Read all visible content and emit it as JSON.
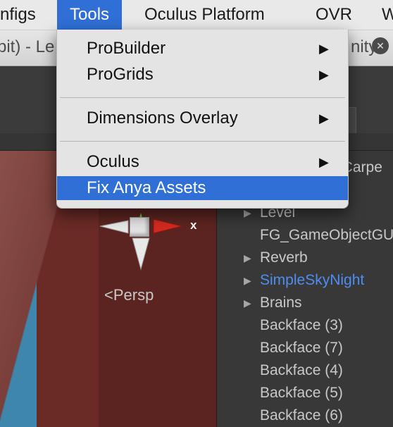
{
  "menubar": {
    "items": [
      "nfigs",
      "Tools",
      "Oculus Platform",
      "OVR",
      "W"
    ]
  },
  "titlebar": {
    "left_text": "bit) - Le",
    "right_text": "nity -"
  },
  "tools_menu": {
    "items": [
      {
        "label": "ProBuilder",
        "submenu": true
      },
      {
        "label": "ProGrids",
        "submenu": true
      },
      {
        "label": "Dimensions Overlay",
        "submenu": true
      },
      {
        "label": "Oculus",
        "submenu": true
      },
      {
        "label": "Fix Anya Assets",
        "submenu": false,
        "highlighted": true
      }
    ],
    "submenu_glyph": "▶"
  },
  "scene": {
    "axis_label": "x",
    "view_label": "Persp",
    "persp_glyph": "<"
  },
  "hierarchy": {
    "header_partial": "dCarpe",
    "rows": [
      {
        "label": "Level",
        "expandable": true
      },
      {
        "label": "FG_GameObjectGU",
        "expandable": false
      },
      {
        "label": "Reverb",
        "expandable": true
      },
      {
        "label": "SimpleSkyNight",
        "expandable": true,
        "link": true
      },
      {
        "label": "Brains",
        "expandable": true
      },
      {
        "label": "Backface (3)",
        "expandable": false
      },
      {
        "label": "Backface (7)",
        "expandable": false
      },
      {
        "label": "Backface (4)",
        "expandable": false
      },
      {
        "label": "Backface (5)",
        "expandable": false
      },
      {
        "label": "Backface (6)",
        "expandable": false
      }
    ],
    "expand_glyph": "▶"
  },
  "colors": {
    "highlight": "#2f6fd6",
    "link": "#4f8df0",
    "scene_red": "#6a2a26",
    "axis_red": "#d42a1f"
  },
  "icons": [
    "submenu-arrow-icon",
    "expand-arrow-icon",
    "persp-icon",
    "gizmo-cube-icon",
    "gizmo-cone-icon"
  ]
}
